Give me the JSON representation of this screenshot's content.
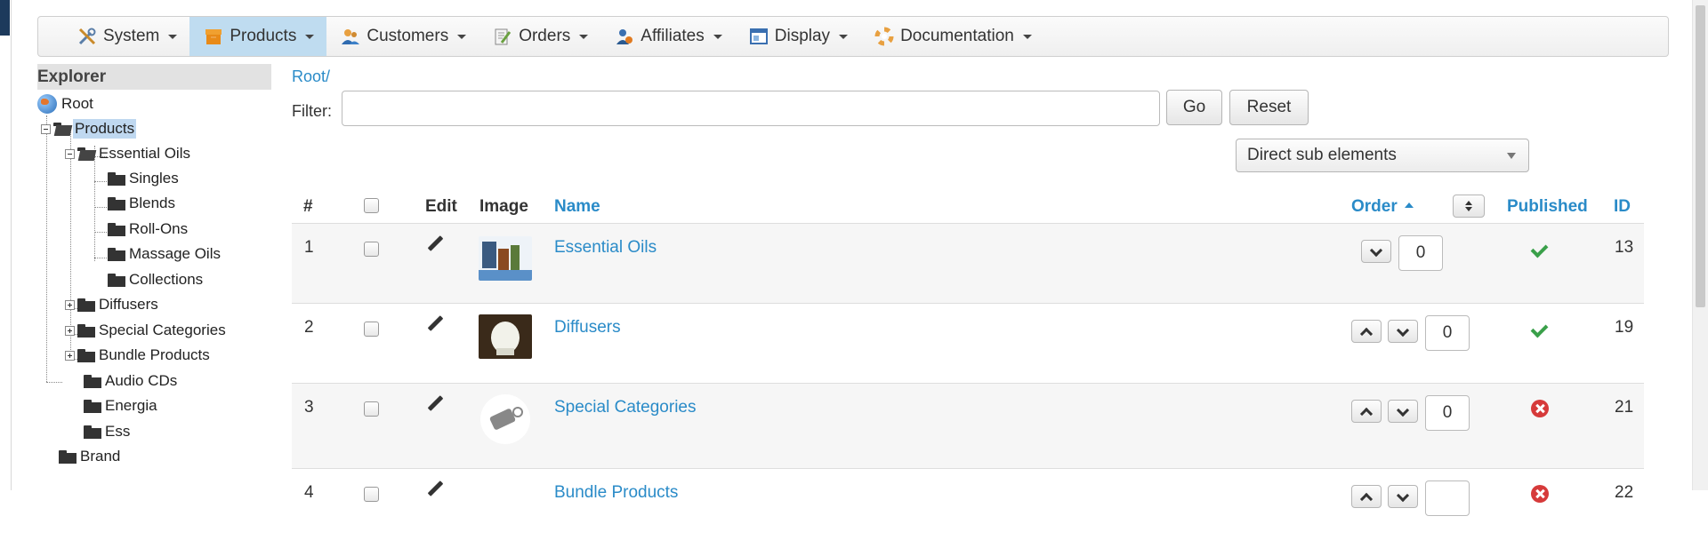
{
  "menu": [
    {
      "label": "System",
      "icon": "wrench-screwdriver-icon",
      "active": false
    },
    {
      "label": "Products",
      "icon": "box-icon",
      "active": true
    },
    {
      "label": "Customers",
      "icon": "users-icon",
      "active": false
    },
    {
      "label": "Orders",
      "icon": "order-pencil-icon",
      "active": false
    },
    {
      "label": "Affiliates",
      "icon": "affiliates-icon",
      "active": false
    },
    {
      "label": "Display",
      "icon": "display-window-icon",
      "active": false
    },
    {
      "label": "Documentation",
      "icon": "lifebuoy-icon",
      "active": false
    }
  ],
  "explorer": {
    "title": "Explorer",
    "nodes": {
      "root": "Root",
      "products": "Products",
      "essential_oils": "Essential Oils",
      "singles": "Singles",
      "blends": "Blends",
      "roll_ons": "Roll-Ons",
      "massage_oils": "Massage Oils",
      "collections": "Collections",
      "diffusers": "Diffusers",
      "special_categories": "Special Categories",
      "bundle_products": "Bundle Products",
      "audio_cds": "Audio CDs",
      "energia": "Energia",
      "ess": "Ess",
      "brand": "Brand"
    }
  },
  "breadcrumb": "Root/",
  "filter": {
    "label": "Filter:",
    "value": "",
    "go_label": "Go",
    "reset_label": "Reset",
    "scope_selected": "Direct sub elements"
  },
  "table": {
    "headers": {
      "num": "#",
      "edit": "Edit",
      "image": "Image",
      "name": "Name",
      "order": "Order",
      "published": "Published",
      "id": "ID"
    },
    "rows": [
      {
        "num": "1",
        "name": "Essential Oils",
        "order": "0",
        "published": true,
        "id": "13"
      },
      {
        "num": "2",
        "name": "Diffusers",
        "order": "0",
        "published": true,
        "id": "19"
      },
      {
        "num": "3",
        "name": "Special Categories",
        "order": "0",
        "published": false,
        "id": "21"
      },
      {
        "num": "4",
        "name": "Bundle Products",
        "order": "",
        "published": false,
        "id": "22"
      }
    ]
  },
  "colors": {
    "link": "#2a8bc8",
    "active_menu": "#bfdcf0",
    "published_yes": "#3aa04a",
    "published_no": "#d63a3a"
  }
}
